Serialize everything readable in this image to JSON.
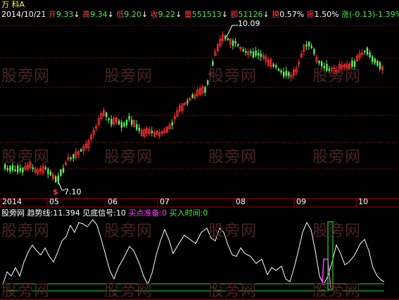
{
  "header": {
    "stock_name": "万 科A",
    "date": "2014/10/21",
    "items": [
      {
        "label": "开",
        "value": "9.33",
        "arrow": "↓"
      },
      {
        "label": "高",
        "value": "9.34",
        "arrow": "↓"
      },
      {
        "label": "低",
        "value": "9.20",
        "arrow": "↓"
      },
      {
        "label": "收",
        "value": "9.22",
        "arrow": "↓"
      },
      {
        "label": "量",
        "value": "551513",
        "arrow": "↓"
      },
      {
        "label": "额",
        "value": "51126",
        "arrow": "↓"
      },
      {
        "label": "换",
        "value": "0.57%",
        "arrow": ""
      },
      {
        "label": "振",
        "value": "1.50%",
        "arrow": ""
      }
    ],
    "change": "涨(-0.13)-1.39%"
  },
  "price_panel": {
    "high_label": "10.09",
    "low_label": "7.10",
    "low_marker": "$"
  },
  "time_axis": {
    "labels": [
      "2014",
      "05",
      "06",
      "07",
      "08",
      "09",
      "10"
    ]
  },
  "indicator": {
    "name": "股旁网",
    "trend_label": "趋势线:",
    "trend_value": "11.394",
    "signal_label": "见底信号:",
    "signal_value": "10",
    "buy_prep_label": "买点准备:",
    "buy_prep_value": "0",
    "buy_time_label": "买入时间:",
    "buy_time_value": "0"
  },
  "watermark": "股旁网",
  "colors": {
    "up": "#ff3030",
    "down": "#5ff05f",
    "grid": "#8b0000",
    "header_text": "#ff4040",
    "header_down": "#44ee44",
    "trend_line": "#ffffff",
    "magenta": "#ff40ff",
    "green_line": "#22dd22"
  },
  "chart_data": {
    "type": "candlestick",
    "x_labels": [
      "2014",
      "05",
      "06",
      "07",
      "08",
      "09",
      "10"
    ],
    "y_range_visible": [
      7.1,
      10.09
    ],
    "annotated_high": 10.09,
    "annotated_low": 7.1
  }
}
